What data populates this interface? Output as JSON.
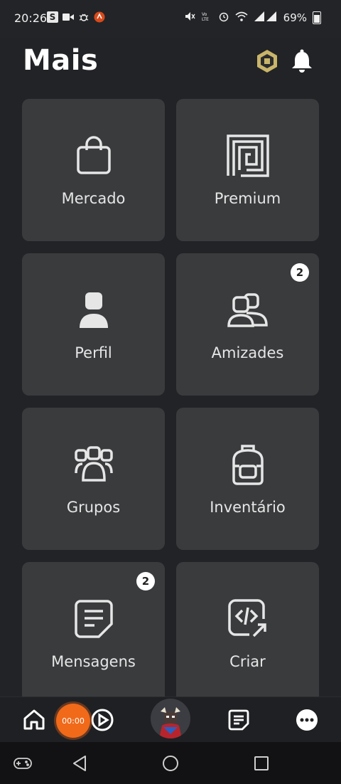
{
  "status_bar": {
    "time": "20:26",
    "s_badge": "S",
    "battery": "69%"
  },
  "header": {
    "title": "Mais"
  },
  "tiles": [
    {
      "label": "Mercado",
      "icon": "shopping-bag-icon"
    },
    {
      "label": "Premium",
      "icon": "premium-icon"
    },
    {
      "label": "Perfil",
      "icon": "profile-icon"
    },
    {
      "label": "Amizades",
      "icon": "friends-icon",
      "badge": "2"
    },
    {
      "label": "Grupos",
      "icon": "groups-icon"
    },
    {
      "label": "Inventário",
      "icon": "backpack-icon"
    },
    {
      "label": "Mensagens",
      "icon": "messages-icon",
      "badge": "2"
    },
    {
      "label": "Criar",
      "icon": "create-code-icon"
    }
  ],
  "bottom_nav": {
    "recorder_time": "00:00",
    "items": [
      "home-icon",
      "play-icon",
      "avatar",
      "feed-icon",
      "more-icon"
    ]
  },
  "colors": {
    "background": "#222326",
    "tile": "#393b3d",
    "recorder": "#f06a1a",
    "robux": "#c9b56a"
  }
}
